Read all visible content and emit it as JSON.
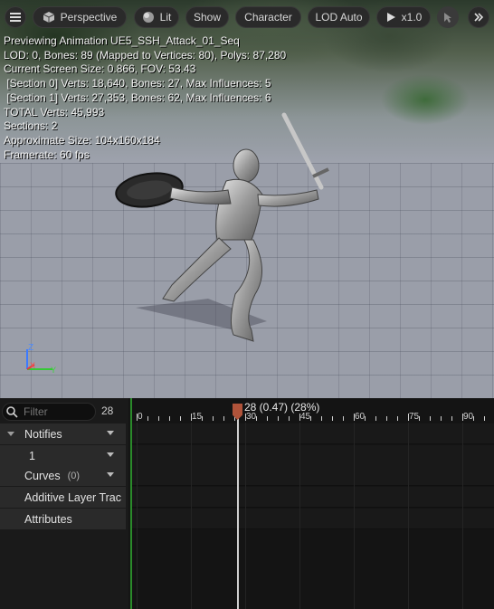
{
  "toolbar": {
    "menu_icon": "hamburger-icon",
    "perspective_label": "Perspective",
    "lit_label": "Lit",
    "show_label": "Show",
    "character_label": "Character",
    "lod_label": "LOD Auto",
    "speed_label": "x1.0",
    "select_icon": "cursor-arrow-icon",
    "more_icon": "double-chevron-icon"
  },
  "stats": {
    "line1": "Previewing Animation UE5_SSH_Attack_01_Seq",
    "line2": "LOD: 0, Bones: 89 (Mapped to Vertices: 80), Polys: 87,280",
    "line3": "Current Screen Size: 0.866, FOV: 53.43",
    "line4": " [Section 0] Verts: 18,640, Bones: 27, Max Influences: 5",
    "line5": " [Section 1] Verts: 27,353, Bones: 62, Max Influences: 6",
    "line6": "TOTAL Verts: 45,993",
    "line7": "Sections: 2",
    "line8": "Approximate Size: 104x160x184",
    "line9": "Framerate: 60 fps"
  },
  "axis": {
    "z": "Z",
    "x": "X",
    "y": "Y"
  },
  "panel": {
    "filter_placeholder": "Filter",
    "frame_count": "28",
    "tracks": {
      "notifies": "Notifies",
      "notify_track": "1",
      "curves": "Curves",
      "curves_count": "(0)",
      "additive": "Additive Layer Trac",
      "attributes": "Attributes"
    }
  },
  "timeline": {
    "ticks": [
      "0",
      "15",
      "30",
      "45",
      "60",
      "75",
      "90"
    ],
    "playhead_label": "28 (0.47) (28%)",
    "playhead_frame": 28,
    "playhead_marker_color": "#b0533a"
  }
}
